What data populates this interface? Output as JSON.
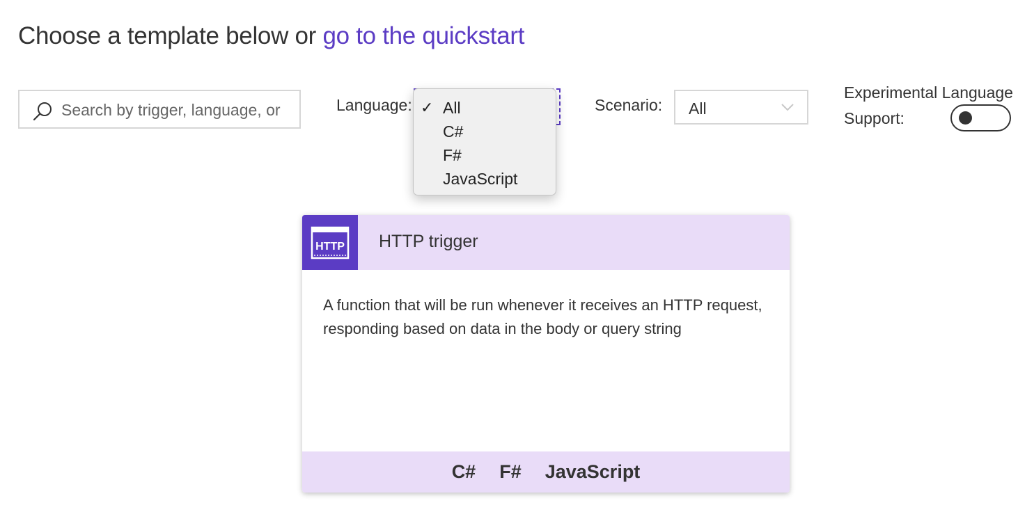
{
  "heading": {
    "prefix": "Choose a template below or",
    "link": "go to the quickstart"
  },
  "search": {
    "placeholder": "Search by trigger, language, or description",
    "value": "",
    "icon": "search-icon"
  },
  "language": {
    "label": "Language:",
    "selected": "All",
    "check_mark": "✓",
    "options": [
      "All",
      "C#",
      "F#",
      "JavaScript"
    ]
  },
  "scenario": {
    "label": "Scenario:",
    "selected": "All",
    "icon": "chevron-down-icon"
  },
  "experimental": {
    "label_line1": "Experimental Language",
    "label_line2": "Support:",
    "enabled": false
  },
  "card": {
    "icon_text": "HTTP",
    "title": "HTTP trigger",
    "description": "A function that will be run whenever it receives an HTTP request, responding based on data in the body or query string",
    "languages": [
      "C#",
      "F#",
      "JavaScript"
    ]
  },
  "colors": {
    "accent": "#5b3cc4",
    "card_header_bg": "#e9dcf8",
    "text": "#333333"
  }
}
